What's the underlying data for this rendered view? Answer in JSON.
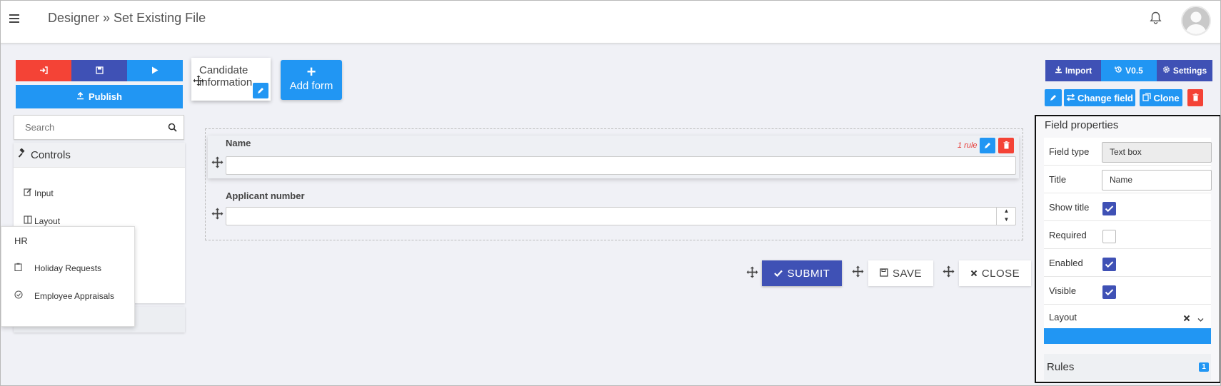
{
  "header": {
    "title": "Designer » Set Existing File"
  },
  "toolbar": {
    "publish_label": "Publish",
    "search_placeholder": "Search",
    "exit_icon": "sign-in-icon",
    "save_icon": "floppy-icon",
    "run_icon": "play-icon",
    "colors": {
      "red": "#f44336",
      "indigo": "#3f51b5",
      "blue": "#2196f3"
    }
  },
  "controls": {
    "heading": "Controls",
    "items": [
      {
        "label": "Input",
        "icon": "edit-icon"
      },
      {
        "label": "Layout",
        "icon": "columns-icon"
      }
    ]
  },
  "popup": {
    "section": "HR",
    "items": [
      {
        "label": "Holiday Requests",
        "icon": "clipboard-icon"
      },
      {
        "label": "Employee Appraisals",
        "icon": "check-circle-icon"
      }
    ]
  },
  "forms": {
    "current": "Candidate information",
    "add_label": "Add form"
  },
  "canvas": {
    "fields": [
      {
        "label": "Name",
        "value": "",
        "rule_text": "1 rule"
      },
      {
        "label": "Applicant number",
        "value": ""
      }
    ],
    "actions": {
      "submit": "SUBMIT",
      "save": "SAVE",
      "close": "CLOSE"
    }
  },
  "right_toolbar": {
    "import": "Import",
    "version": "V0.5",
    "settings": "Settings",
    "change_field": "Change field",
    "clone": "Clone"
  },
  "properties": {
    "heading": "Field properties",
    "field_type_label": "Field type",
    "field_type_value": "Text box",
    "title_label": "Title",
    "title_value": "Name",
    "show_title_label": "Show title",
    "show_title": true,
    "required_label": "Required",
    "required": false,
    "enabled_label": "Enabled",
    "enabled": true,
    "visible_label": "Visible",
    "visible": true,
    "layout_label": "Layout",
    "rules_label": "Rules",
    "rules_count": "1"
  }
}
